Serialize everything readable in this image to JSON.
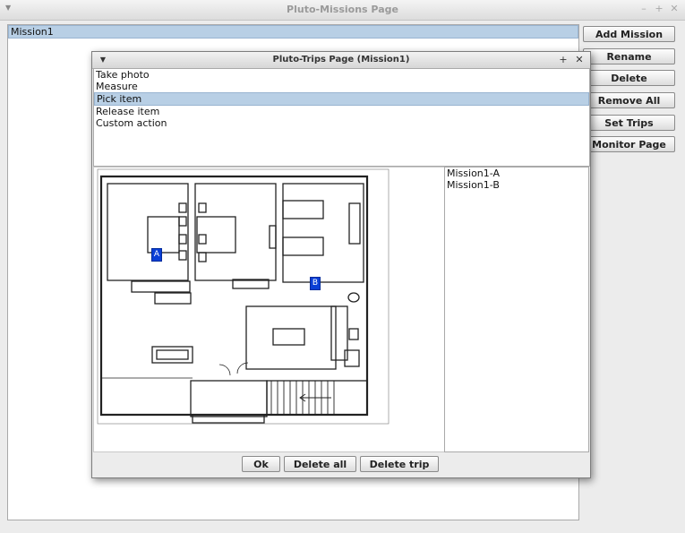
{
  "main_window": {
    "title": "Pluto-Missions Page",
    "missions": [
      "Mission1"
    ],
    "buttons": {
      "add_mission": "Add Mission",
      "rename": "Rename",
      "delete": "Delete",
      "remove_all": "Remove All",
      "set_trips": "Set Trips",
      "monitor_page": "Monitor Page"
    }
  },
  "trips_dialog": {
    "title": "Pluto-Trips Page (Mission1)",
    "actions": [
      "Take photo",
      "Measure",
      "Pick item",
      "Release item",
      "Custom action"
    ],
    "selected_action": "Pick item",
    "map_markers": [
      "A",
      "B"
    ],
    "trips": [
      "Mission1-A",
      "Mission1-B"
    ],
    "buttons": {
      "ok": "Ok",
      "delete_all": "Delete all",
      "delete_trip": "Delete trip"
    }
  }
}
